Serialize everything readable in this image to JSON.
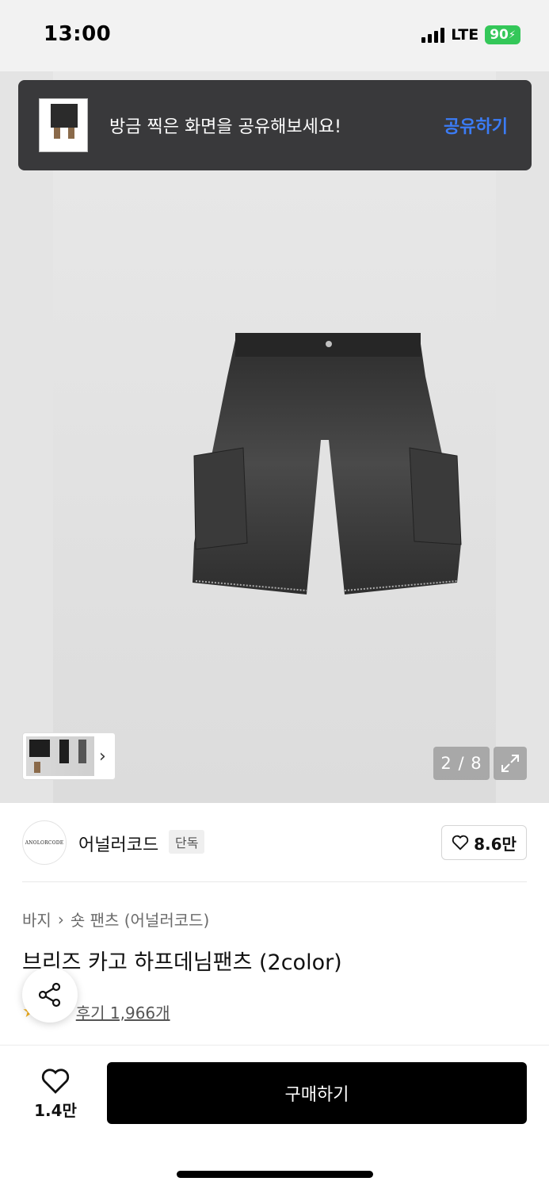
{
  "status_bar": {
    "time": "13:00",
    "network": "LTE",
    "battery": "90"
  },
  "toast": {
    "message": "방금 찍은 화면을 공유해보세요!",
    "action_label": "공유하기"
  },
  "gallery": {
    "page_counter": "2 / 8",
    "current_page": 2,
    "total_pages": 8
  },
  "brand": {
    "logo_text": "ANOLORCODE",
    "name": "어널러코드",
    "badge": "단독",
    "like_count": "8.6만"
  },
  "breadcrumb": {
    "category": "바지",
    "subcategory": "숏 팬츠 (어널러코드)"
  },
  "product": {
    "title": "브리즈 카고 하프데님팬츠 (2color)",
    "review_label": "후기 1,966개"
  },
  "bottom_bar": {
    "like_count": "1.4만",
    "buy_label": "구매하기"
  },
  "colors": {
    "accent_blue": "#3b7cf6",
    "battery_green": "#34c759",
    "toast_bg": "#39393b",
    "star": "#f2b01e"
  },
  "icons": [
    "signal-icon",
    "battery-icon",
    "chevron-right-icon",
    "expand-icon",
    "heart-icon",
    "share-icon",
    "star-icon"
  ]
}
